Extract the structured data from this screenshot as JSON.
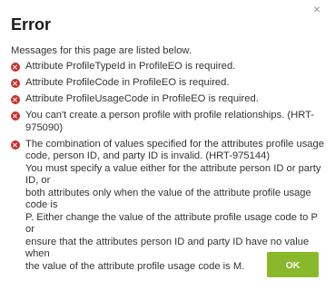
{
  "dialog": {
    "close_label": "×",
    "title": "Error",
    "intro": "Messages for this page are listed below.",
    "messages": [
      {
        "text": "Attribute ProfileTypeId in ProfileEO is required."
      },
      {
        "text": "Attribute ProfileCode in ProfileEO is required."
      },
      {
        "text": "Attribute ProfileUsageCode in ProfileEO is required."
      },
      {
        "text": "You can't create a person profile with profile relationships. (HRT-\n975090)"
      },
      {
        "text": "The combination of values specified for the attributes profile usage\ncode, person ID, and party ID is invalid. (HRT-975144)\nYou must specify a value either for the attribute person ID or party ID, or\nboth attributes only when the value of the attribute profile usage code is\nP. Either change the value of the attribute profile usage code to P or\nensure that the attributes person ID and party ID have no value when\nthe value of the attribute profile usage code is M."
      }
    ],
    "ok_label": "OK"
  },
  "colors": {
    "error_icon": "#c9302c",
    "ok_button": "#8ab82b",
    "text": "#333333"
  },
  "icons": {
    "close": "close-icon",
    "error": "error-icon"
  }
}
